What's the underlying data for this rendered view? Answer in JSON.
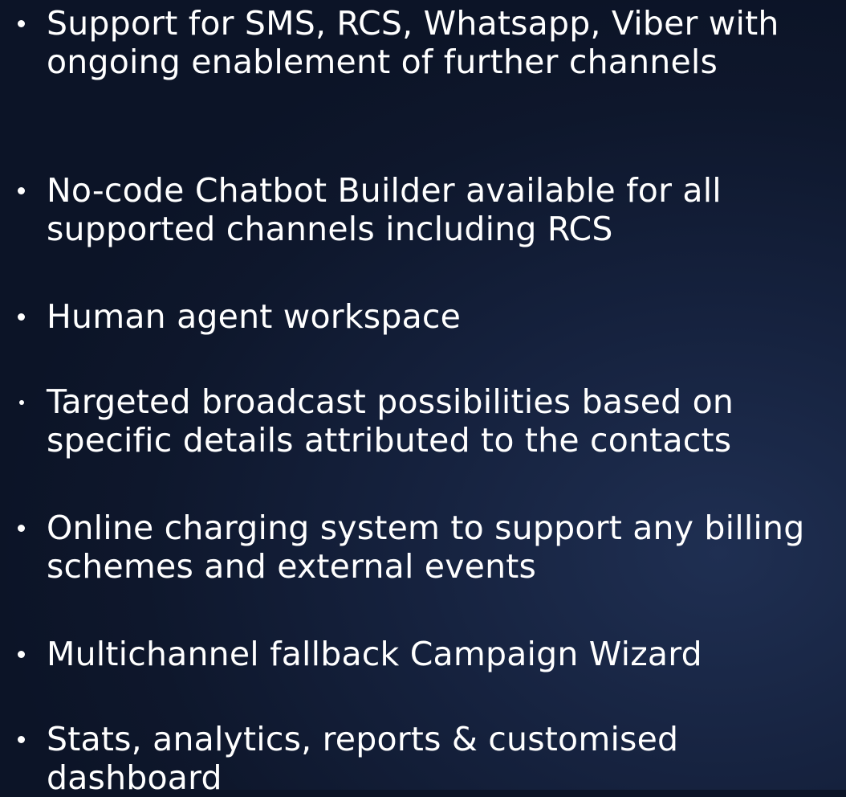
{
  "bullets": [
    {
      "text": "Support for SMS, RCS, Whatsapp, Viber with ongoing enablement of further channels"
    },
    {
      "text": "No-code Chatbot Builder available for all supported channels including RCS"
    },
    {
      "text": "Human agent workspace"
    },
    {
      "text": "Targeted broadcast possibilities based on specific details attributed to the contacts"
    },
    {
      "text": "Online charging system to support any billing schemes and external events"
    },
    {
      "text": "Multichannel fallback Campaign Wizard"
    },
    {
      "text": "Stats, analytics, reports & customised dashboard"
    }
  ]
}
